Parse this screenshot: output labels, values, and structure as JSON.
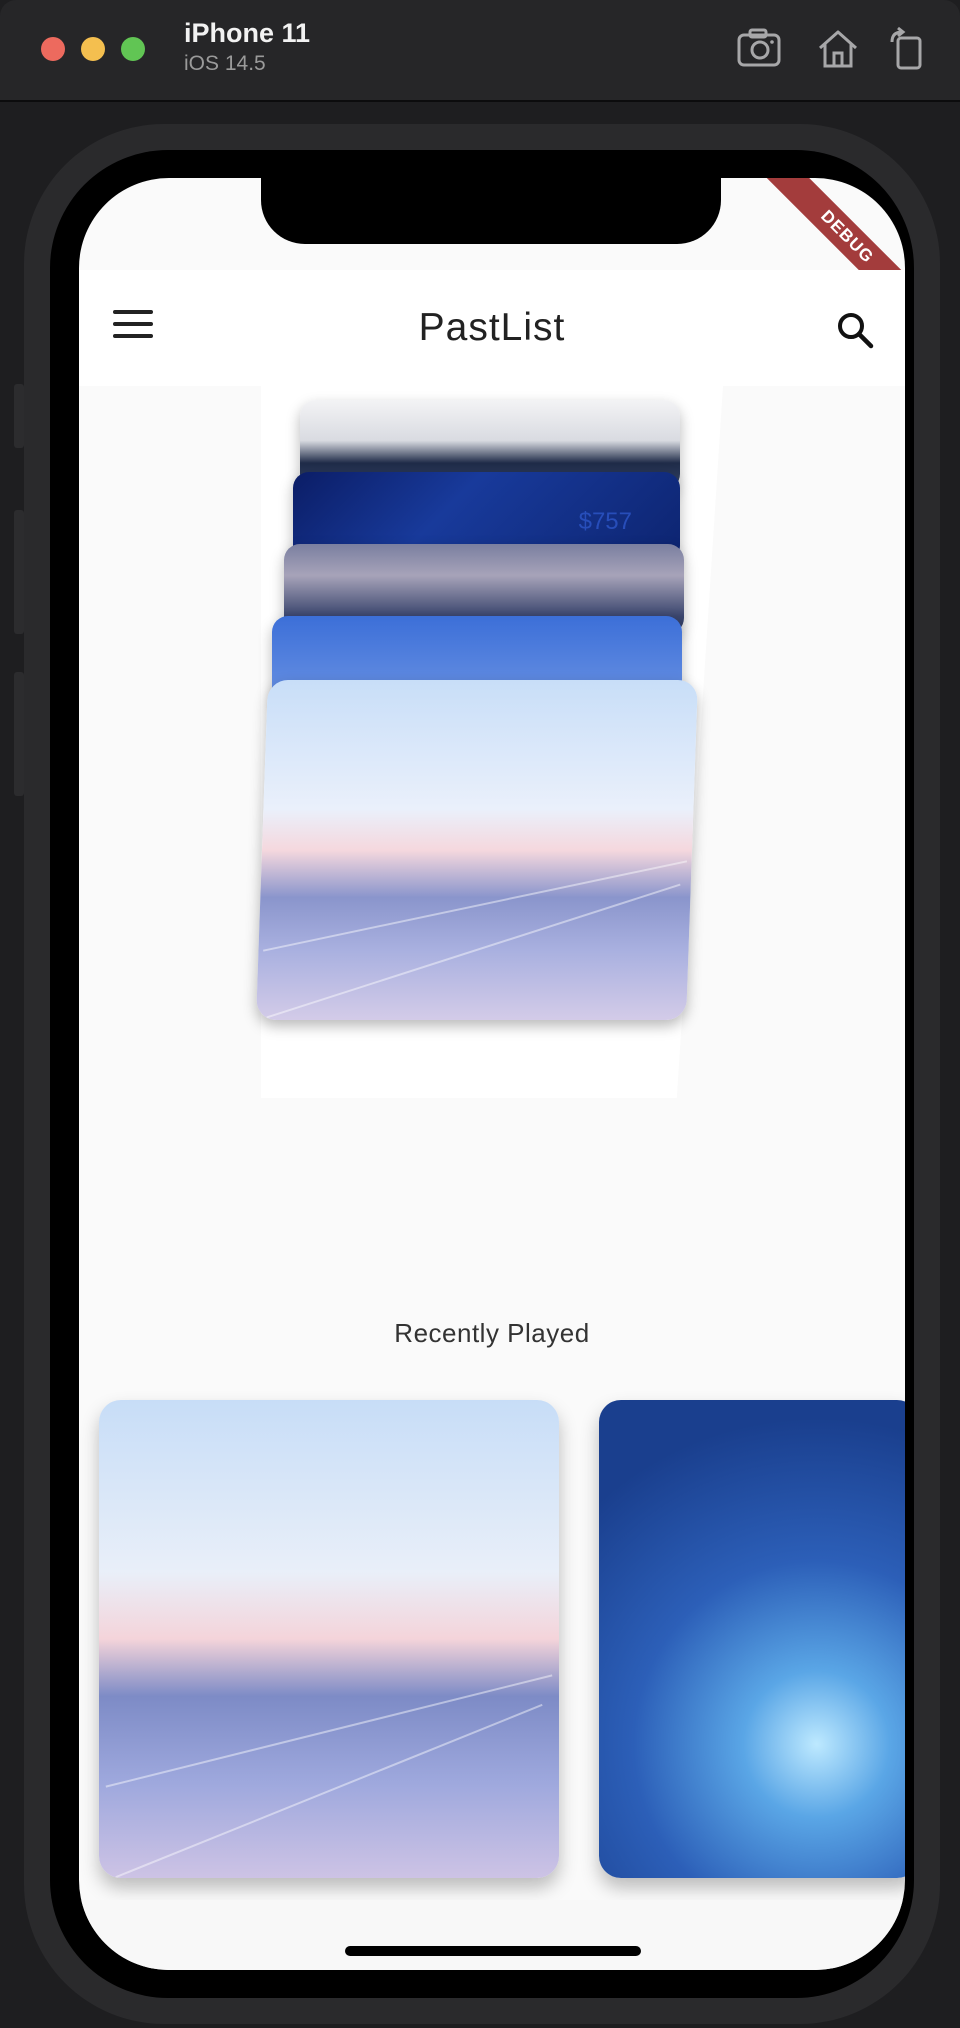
{
  "simulator": {
    "device_name": "iPhone 11",
    "os_version": "iOS 14.5",
    "icons": [
      "screenshot-icon",
      "home-icon",
      "rotate-icon"
    ]
  },
  "app": {
    "title": "PastList",
    "debug_banner": "DEBUG",
    "menu_icon": "hamburger-menu-icon",
    "search_icon": "search-icon"
  },
  "card_stack": {
    "cards": [
      {
        "image": "businessman-holding-card"
      },
      {
        "image": "blue-finance-chart",
        "overlay_text": "$757"
      },
      {
        "image": "network-connections"
      },
      {
        "image": "city-skyline-blue"
      },
      {
        "image": "river-city-sunset-network"
      }
    ]
  },
  "recently_played": {
    "title": "Recently Played",
    "items": [
      {
        "image": "river-city-sunset-network"
      },
      {
        "image": "city-towers-network-lights"
      }
    ]
  },
  "colors": {
    "app_background": "#fafafa",
    "appbar_background": "#ffffff",
    "debug_banner": "#a33c3c",
    "text_primary": "#222222"
  }
}
